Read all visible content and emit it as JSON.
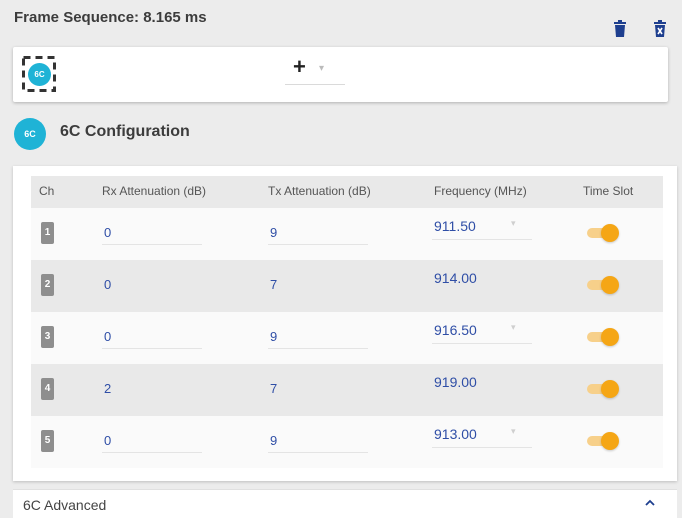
{
  "frame": {
    "title": "Frame Sequence: 8.165 ms"
  },
  "sequence": {
    "chip_label": "6C",
    "add_label": "+"
  },
  "config": {
    "icon_label": "6C",
    "title": "6C Configuration"
  },
  "table": {
    "headers": [
      "Ch",
      "Rx Attenuation (dB)",
      "Tx Attenuation (dB)",
      "Frequency (MHz)",
      "Time Slot"
    ],
    "rows": [
      {
        "ch": "1",
        "rx": "0",
        "tx": "9",
        "freq": "911.50",
        "time_slot_on": true
      },
      {
        "ch": "2",
        "rx": "0",
        "tx": "7",
        "freq": "914.00",
        "time_slot_on": true
      },
      {
        "ch": "3",
        "rx": "0",
        "tx": "9",
        "freq": "916.50",
        "time_slot_on": true
      },
      {
        "ch": "4",
        "rx": "2",
        "tx": "7",
        "freq": "919.00",
        "time_slot_on": true
      },
      {
        "ch": "5",
        "rx": "0",
        "tx": "9",
        "freq": "913.00",
        "time_slot_on": true
      }
    ]
  },
  "advanced": {
    "label": "6C Advanced"
  },
  "colors": {
    "accent_teal": "#1fb3d6",
    "toggle_on": "#f5a615",
    "value_blue": "#2f4ea6",
    "trash_blue": "#1e3f8f"
  },
  "icons": {
    "delete": "trash-icon",
    "delete_all": "trash-x-icon",
    "collapse": "chevron-up-icon"
  }
}
